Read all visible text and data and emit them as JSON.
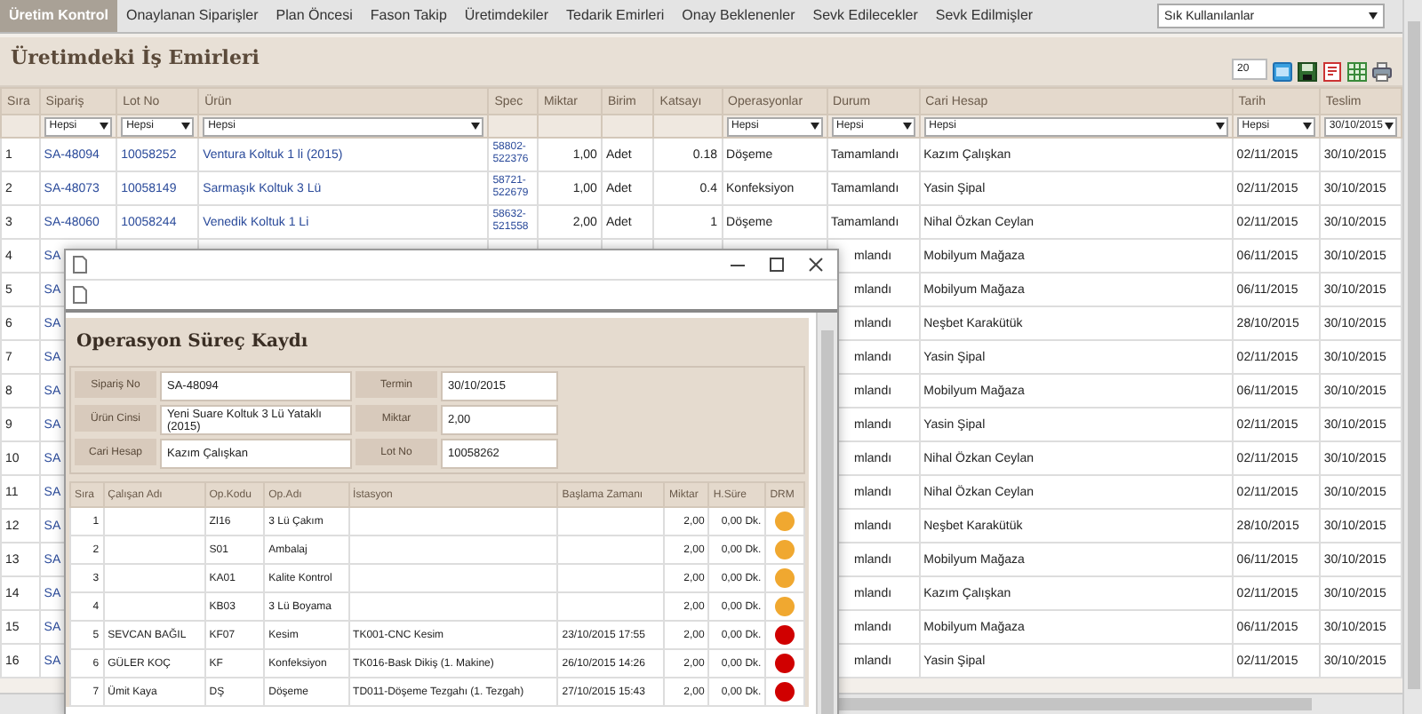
{
  "tabs": [
    {
      "label": "Üretim Kontrol",
      "selected": true
    },
    {
      "label": "Onaylanan Siparişler",
      "selected": false
    },
    {
      "label": "Plan Öncesi",
      "selected": false
    },
    {
      "label": "Fason Takip",
      "selected": false
    },
    {
      "label": "Üretimdekiler",
      "selected": false
    },
    {
      "label": "Tedarik Emirleri",
      "selected": false
    },
    {
      "label": "Onay Beklenenler",
      "selected": false
    },
    {
      "label": "Sevk Edilecekler",
      "selected": false
    },
    {
      "label": "Sevk Edilmişler",
      "selected": false
    }
  ],
  "favorites_dropdown": {
    "value": "Sık Kullanılanlar"
  },
  "title": "Üretimdeki İş Emirleri",
  "page_size": "20",
  "table": {
    "columns": [
      {
        "label": "Sıra"
      },
      {
        "label": "Sipariş",
        "filter": "Hepsi"
      },
      {
        "label": "Lot No",
        "filter": "Hepsi"
      },
      {
        "label": "Ürün",
        "filter": "Hepsi"
      },
      {
        "label": "Spec"
      },
      {
        "label": "Miktar"
      },
      {
        "label": "Birim"
      },
      {
        "label": "Katsayı"
      },
      {
        "label": "Operasyonlar",
        "filter": "Hepsi"
      },
      {
        "label": "Durum",
        "filter": "Hepsi"
      },
      {
        "label": "Cari Hesap",
        "filter": "Hepsi"
      },
      {
        "label": "Tarih",
        "filter": "Hepsi"
      },
      {
        "label": "Teslim",
        "filter": "30/10/2015"
      }
    ],
    "rows": [
      {
        "sira": "1",
        "siparis": "SA-48094",
        "lot_no": "10058252",
        "urun": "Ventura Koltuk 1 li (2015)",
        "spec": "58802-522376",
        "miktar": "1,00",
        "birim": "Adet",
        "katsayi": "0.18",
        "operasyonlar": "Döşeme",
        "durum": "Tamamlandı",
        "cari_hesap": "Kazım Çalışkan",
        "tarih": "02/11/2015",
        "teslim": "30/10/2015"
      },
      {
        "sira": "2",
        "siparis": "SA-48073",
        "lot_no": "10058149",
        "urun": "Sarmaşık Koltuk 3 Lü",
        "spec": "58721-522679",
        "miktar": "1,00",
        "birim": "Adet",
        "katsayi": "0.4",
        "operasyonlar": "Konfeksiyon",
        "durum": "Tamamlandı",
        "cari_hesap": "Yasin Şipal",
        "tarih": "02/11/2015",
        "teslim": "30/10/2015"
      },
      {
        "sira": "3",
        "siparis": "SA-48060",
        "lot_no": "10058244",
        "urun": "Venedik Koltuk 1 Li",
        "spec": "58632-521558",
        "miktar": "2,00",
        "birim": "Adet",
        "katsayi": "1",
        "operasyonlar": "Döşeme",
        "durum": "Tamamlandı",
        "cari_hesap": "Nihal Özkan Ceylan",
        "tarih": "02/11/2015",
        "teslim": "30/10/2015"
      },
      {
        "sira": "4",
        "siparis": "SA",
        "durum": "mlandı",
        "cari_hesap": "Mobilyum Mağaza",
        "tarih": "06/11/2015",
        "teslim": "30/10/2015"
      },
      {
        "sira": "5",
        "siparis": "SA",
        "durum": "mlandı",
        "cari_hesap": "Mobilyum Mağaza",
        "tarih": "06/11/2015",
        "teslim": "30/10/2015"
      },
      {
        "sira": "6",
        "siparis": "SA",
        "durum": "mlandı",
        "cari_hesap": "Neşbet Karakütük",
        "tarih": "28/10/2015",
        "teslim": "30/10/2015"
      },
      {
        "sira": "7",
        "siparis": "SA",
        "durum": "mlandı",
        "cari_hesap": "Yasin Şipal",
        "tarih": "02/11/2015",
        "teslim": "30/10/2015"
      },
      {
        "sira": "8",
        "siparis": "SA",
        "durum": "mlandı",
        "cari_hesap": "Mobilyum Mağaza",
        "tarih": "06/11/2015",
        "teslim": "30/10/2015"
      },
      {
        "sira": "9",
        "siparis": "SA",
        "durum": "mlandı",
        "cari_hesap": "Yasin Şipal",
        "tarih": "02/11/2015",
        "teslim": "30/10/2015"
      },
      {
        "sira": "10",
        "siparis": "SA",
        "durum": "mlandı",
        "cari_hesap": "Nihal Özkan Ceylan",
        "tarih": "02/11/2015",
        "teslim": "30/10/2015"
      },
      {
        "sira": "11",
        "siparis": "SA",
        "durum": "mlandı",
        "cari_hesap": "Nihal Özkan Ceylan",
        "tarih": "02/11/2015",
        "teslim": "30/10/2015"
      },
      {
        "sira": "12",
        "siparis": "SA",
        "durum": "mlandı",
        "cari_hesap": "Neşbet Karakütük",
        "tarih": "28/10/2015",
        "teslim": "30/10/2015"
      },
      {
        "sira": "13",
        "siparis": "SA",
        "durum": "mlandı",
        "cari_hesap": "Mobilyum Mağaza",
        "tarih": "06/11/2015",
        "teslim": "30/10/2015"
      },
      {
        "sira": "14",
        "siparis": "SA",
        "durum": "mlandı",
        "cari_hesap": "Kazım Çalışkan",
        "tarih": "02/11/2015",
        "teslim": "30/10/2015"
      },
      {
        "sira": "15",
        "siparis": "SA",
        "durum": "mlandı",
        "cari_hesap": "Mobilyum Mağaza",
        "tarih": "06/11/2015",
        "teslim": "30/10/2015"
      },
      {
        "sira": "16",
        "siparis": "SA",
        "durum": "mlandı",
        "cari_hesap": "Yasin Şipal",
        "tarih": "02/11/2015",
        "teslim": "30/10/2015"
      }
    ]
  },
  "dialog": {
    "heading": "Operasyon Süreç Kaydı",
    "fields": [
      {
        "label": "Sipariş No",
        "value": "SA-48094"
      },
      {
        "label": "Termin",
        "value": "30/10/2015"
      },
      {
        "label": "Ürün Cinsi",
        "value": "Yeni Suare Koltuk 3 Lü Yataklı (2015)"
      },
      {
        "label": "Miktar",
        "value": "2,00"
      },
      {
        "label": "Cari Hesap",
        "value": "Kazım Çalışkan"
      },
      {
        "label": "Lot No",
        "value": "10058262"
      }
    ],
    "columns": [
      "Sıra",
      "Çalışan Adı",
      "Op.Kodu",
      "Op.Adı",
      "İstasyon",
      "Başlama Zamanı",
      "Miktar",
      "H.Süre",
      "DRM"
    ],
    "rows": [
      {
        "sira": "1",
        "op_kodu": "ZI16",
        "op_adi": "3 Lü Çakım",
        "miktar": "2,00",
        "sure": "0,00 Dk.",
        "color": "#f0a830"
      },
      {
        "sira": "2",
        "op_kodu": "S01",
        "op_adi": "Ambalaj",
        "miktar": "2,00",
        "sure": "0,00 Dk.",
        "color": "#f0a830"
      },
      {
        "sira": "3",
        "op_kodu": "KA01",
        "op_adi": "Kalite Kontrol",
        "miktar": "2,00",
        "sure": "0,00 Dk.",
        "color": "#f0a830"
      },
      {
        "sira": "4",
        "op_kodu": "KB03",
        "op_adi": "3 Lü Boyama",
        "miktar": "2,00",
        "sure": "0,00 Dk.",
        "color": "#f0a830"
      },
      {
        "sira": "5",
        "calisan": "SEVCAN BAĞIL",
        "op_kodu": "KF07",
        "op_adi": "Kesim",
        "istasyon": "TK001-CNC Kesim",
        "baslama": "23/10/2015 17:55",
        "miktar": "2,00",
        "sure": "0,00 Dk.",
        "color": "#d00000"
      },
      {
        "sira": "6",
        "calisan": "GÜLER KOÇ",
        "op_kodu": "KF",
        "op_adi": "Konfeksiyon",
        "istasyon": "TK016-Bask Dikiş (1. Makine)",
        "baslama": "26/10/2015 14:26",
        "miktar": "2,00",
        "sure": "0,00 Dk.",
        "color": "#d00000"
      },
      {
        "sira": "7",
        "calisan": "Ümit Kaya",
        "op_kodu": "DŞ",
        "op_adi": "Döşeme",
        "istasyon": "TD011-Döşeme Tezgahı (1. Tezgah)",
        "baslama": "27/10/2015 15:43",
        "miktar": "2,00",
        "sure": "0,00 Dk.",
        "color": "#d00000"
      }
    ]
  }
}
